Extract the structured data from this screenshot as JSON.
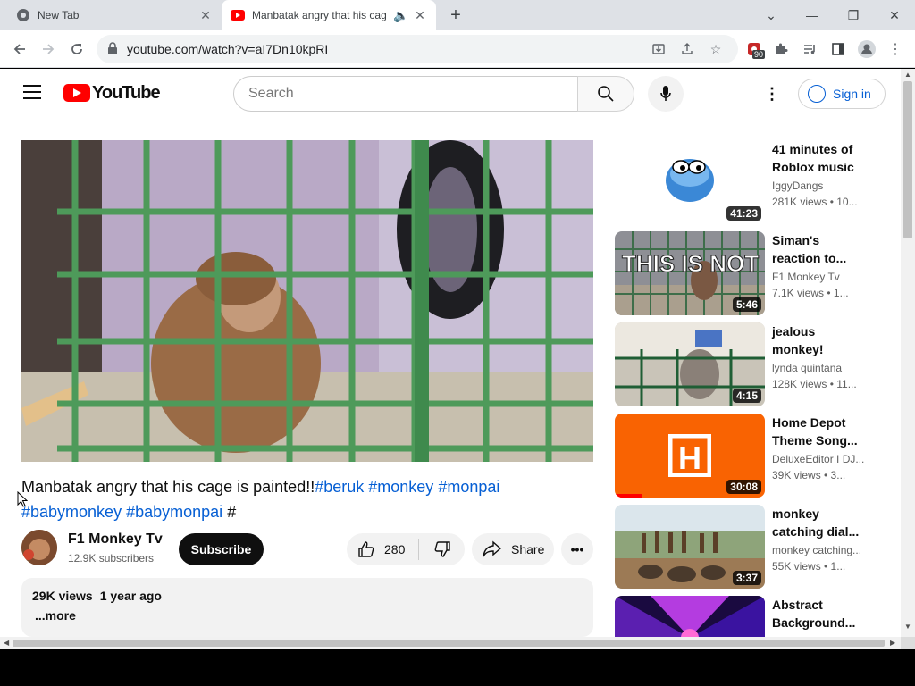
{
  "browser": {
    "tabs": [
      {
        "title": "New Tab",
        "active": false
      },
      {
        "title": "Manbatak angry that his cag",
        "active": true
      }
    ],
    "url": "youtube.com/watch?v=aI7Dn10kpRI",
    "extension_badge": "90"
  },
  "header": {
    "logo_text": "YouTube",
    "search_placeholder": "Search",
    "signin_label": "Sign in"
  },
  "video": {
    "title": "Manbatak angry that his cage is painted!!",
    "hashtags_inline": [
      "#beruk",
      "#monkey",
      "#monpai"
    ],
    "hashtags_line2": [
      "#babymonkey",
      "#babymonpai"
    ],
    "trailing": "#",
    "channel": {
      "name": "F1 Monkey Tv",
      "subscribers": "12.9K subscribers"
    },
    "subscribe_label": "Subscribe",
    "likes": "280",
    "share_label": "Share",
    "views": "29K views",
    "age": "1 year ago",
    "more_label": "...more"
  },
  "recommendations": [
    {
      "title": "41 minutes of Roblox music",
      "channel": "IggyDangs",
      "meta": "281K views • 10...",
      "duration": "41:23",
      "thumb": "blob"
    },
    {
      "title": "Siman's reaction to...",
      "channel": "F1 Monkey Tv",
      "meta": "7.1K views • 1...",
      "duration": "5:46",
      "thumb": "cage"
    },
    {
      "title": "jealous monkey!",
      "channel": "lynda quintana",
      "meta": "128K views • 11...",
      "duration": "4:15",
      "thumb": "fence"
    },
    {
      "title": "Home Depot Theme Song...",
      "channel": "DeluxeEditor I DJ...",
      "meta": "39K views • 3...",
      "duration": "30:08",
      "thumb": "orange"
    },
    {
      "title": "monkey catching dial...",
      "channel": "monkey catching...",
      "meta": "55K views • 1...",
      "duration": "3:37",
      "thumb": "field"
    },
    {
      "title": "Abstract Background...",
      "channel": "",
      "meta": "",
      "duration": "",
      "thumb": "neon"
    }
  ],
  "thumb_text": {
    "cage": "THIS IS NOT MY SON!!"
  },
  "colors": {
    "brand_red": "#ff0000",
    "link_blue": "#065fd4",
    "cage_green": "#4e9a5a",
    "home_depot_orange": "#f96302"
  }
}
